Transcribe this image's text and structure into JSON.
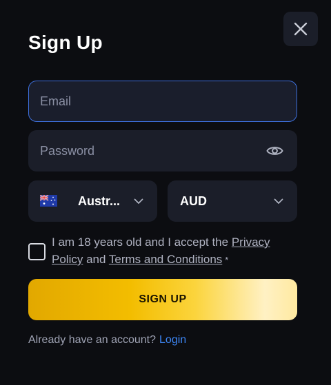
{
  "modal": {
    "title": "Sign Up",
    "close_icon": "close-icon"
  },
  "form": {
    "email": {
      "placeholder": "Email",
      "value": ""
    },
    "password": {
      "placeholder": "Password",
      "value": "",
      "icon": "eye-icon"
    },
    "country": {
      "selected": "Austr...",
      "flag": "australia-flag-icon",
      "icon": "chevron-down-icon"
    },
    "currency": {
      "selected": "AUD",
      "icon": "chevron-down-icon"
    },
    "terms": {
      "checked": false,
      "text_before": "I am 18 years old and I accept the ",
      "privacy_link": "Privacy Policy",
      "and": " and ",
      "terms_link": "Terms and Conditions",
      "required_mark": "*"
    },
    "submit_label": "SIGN UP"
  },
  "footer": {
    "prompt": "Already have an account?",
    "login_link": "Login"
  },
  "colors": {
    "background": "#0c0d11",
    "field_bg": "#1b1e29",
    "focus_border": "#3d6fdc",
    "accent_link": "#3d86f5",
    "button_gold": "#f3bd00"
  }
}
